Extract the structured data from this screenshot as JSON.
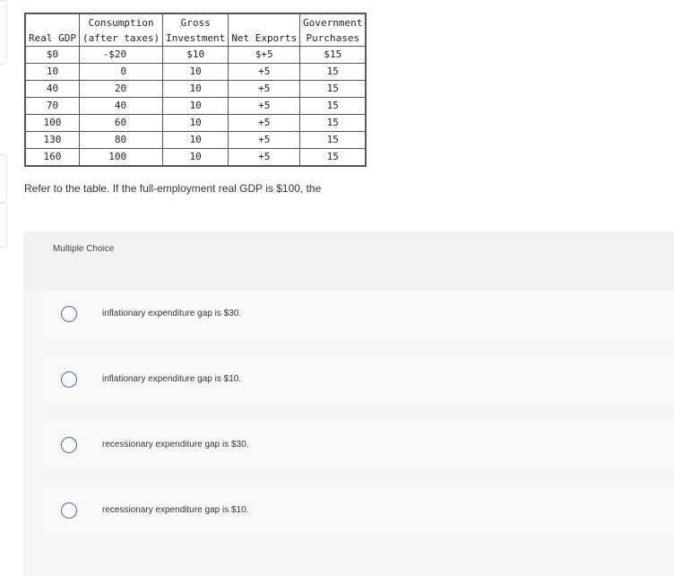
{
  "table": {
    "headers": [
      "Real GDP",
      "Consumption\n(after taxes)",
      "Gross\nInvestment",
      "Net Exports",
      "Government\nPurchases"
    ],
    "header_lines": [
      [
        "",
        "Real GDP"
      ],
      [
        "Consumption",
        "(after taxes)"
      ],
      [
        "Gross",
        "Investment"
      ],
      [
        "",
        "Net Exports"
      ],
      [
        "Government",
        "Purchases"
      ]
    ],
    "rows": [
      [
        "$0",
        "-$20",
        "$10",
        "$+5",
        "$15"
      ],
      [
        "10",
        "0",
        "10",
        "+5",
        "15"
      ],
      [
        "40",
        "20",
        "10",
        "+5",
        "15"
      ],
      [
        "70",
        "40",
        "10",
        "+5",
        "15"
      ],
      [
        "100",
        "60",
        "10",
        "+5",
        "15"
      ],
      [
        "130",
        "80",
        "10",
        "+5",
        "15"
      ],
      [
        "160",
        "100",
        "10",
        "+5",
        "15"
      ]
    ]
  },
  "question": "Refer to the table. If the full-employment real GDP is $100, the",
  "multiple_choice_label": "Multiple Choice",
  "options": [
    {
      "label": "inflationary expenditure gap is $30.",
      "selected": false
    },
    {
      "label": "inflationary expenditure gap is $10.",
      "selected": false
    },
    {
      "label": "recessionary expenditure gap is $30.",
      "selected": false
    },
    {
      "label": "recessionary expenditure gap is $10.",
      "selected": false
    }
  ],
  "colors": {
    "radio": "#3b6ea5",
    "panel": "#f2f2f2"
  }
}
